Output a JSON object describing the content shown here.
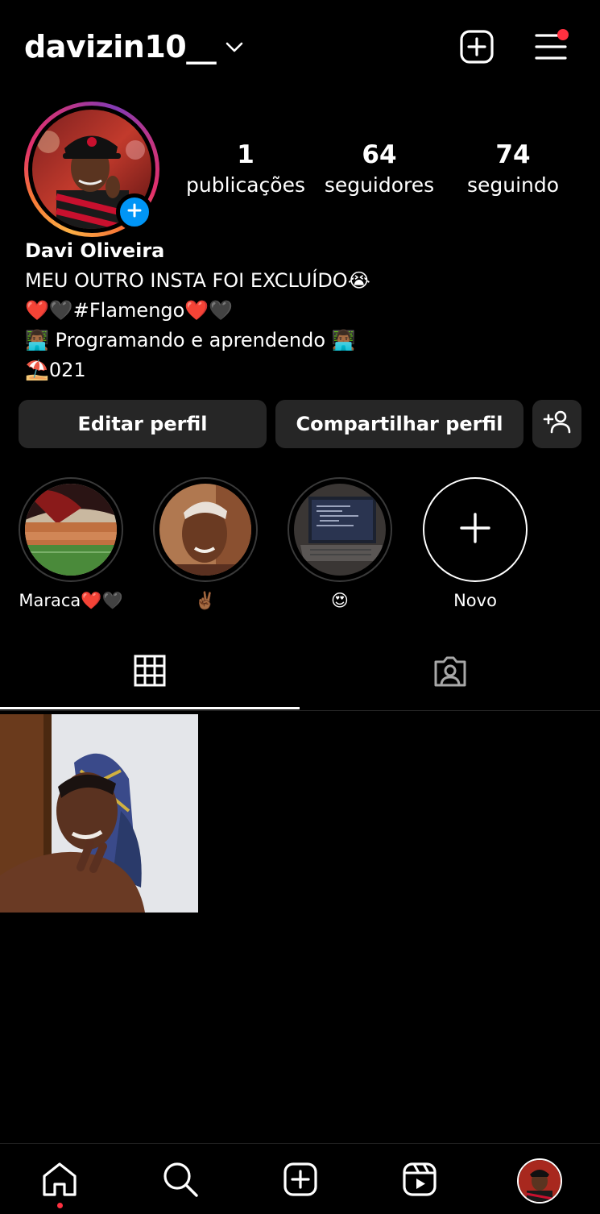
{
  "header": {
    "username": "davizin10__",
    "has_notification": true
  },
  "profile": {
    "stats": [
      {
        "value": "1",
        "label": "publicações"
      },
      {
        "value": "64",
        "label": "seguidores"
      },
      {
        "value": "74",
        "label": "seguindo"
      }
    ],
    "name": "Davi Oliveira",
    "bio_lines": [
      "MEU OUTRO INSTA FOI EXCLUÍDO😭",
      "❤️🖤#Flamengo❤️🖤",
      "👨🏾‍💻 Programando e aprendendo 👨🏾‍💻",
      "⛱️021"
    ]
  },
  "actions": {
    "edit_label": "Editar perfil",
    "share_label": "Compartilhar perfil"
  },
  "highlights": [
    {
      "label": "Maraca❤️🖤"
    },
    {
      "label": "✌🏾"
    },
    {
      "label": "😍"
    },
    {
      "label": "Novo"
    }
  ],
  "icons": {
    "header": [
      "chevron-down-icon",
      "plus-square-icon",
      "menu-icon"
    ],
    "tabs": [
      "grid-icon",
      "tagged-icon"
    ],
    "nav": [
      "home-icon",
      "search-icon",
      "create-icon",
      "reels-icon",
      "profile-avatar"
    ]
  },
  "colors": {
    "background": "#000000",
    "button": "#262626",
    "accent_blue": "#0095f6",
    "notification_red": "#ff3040"
  }
}
